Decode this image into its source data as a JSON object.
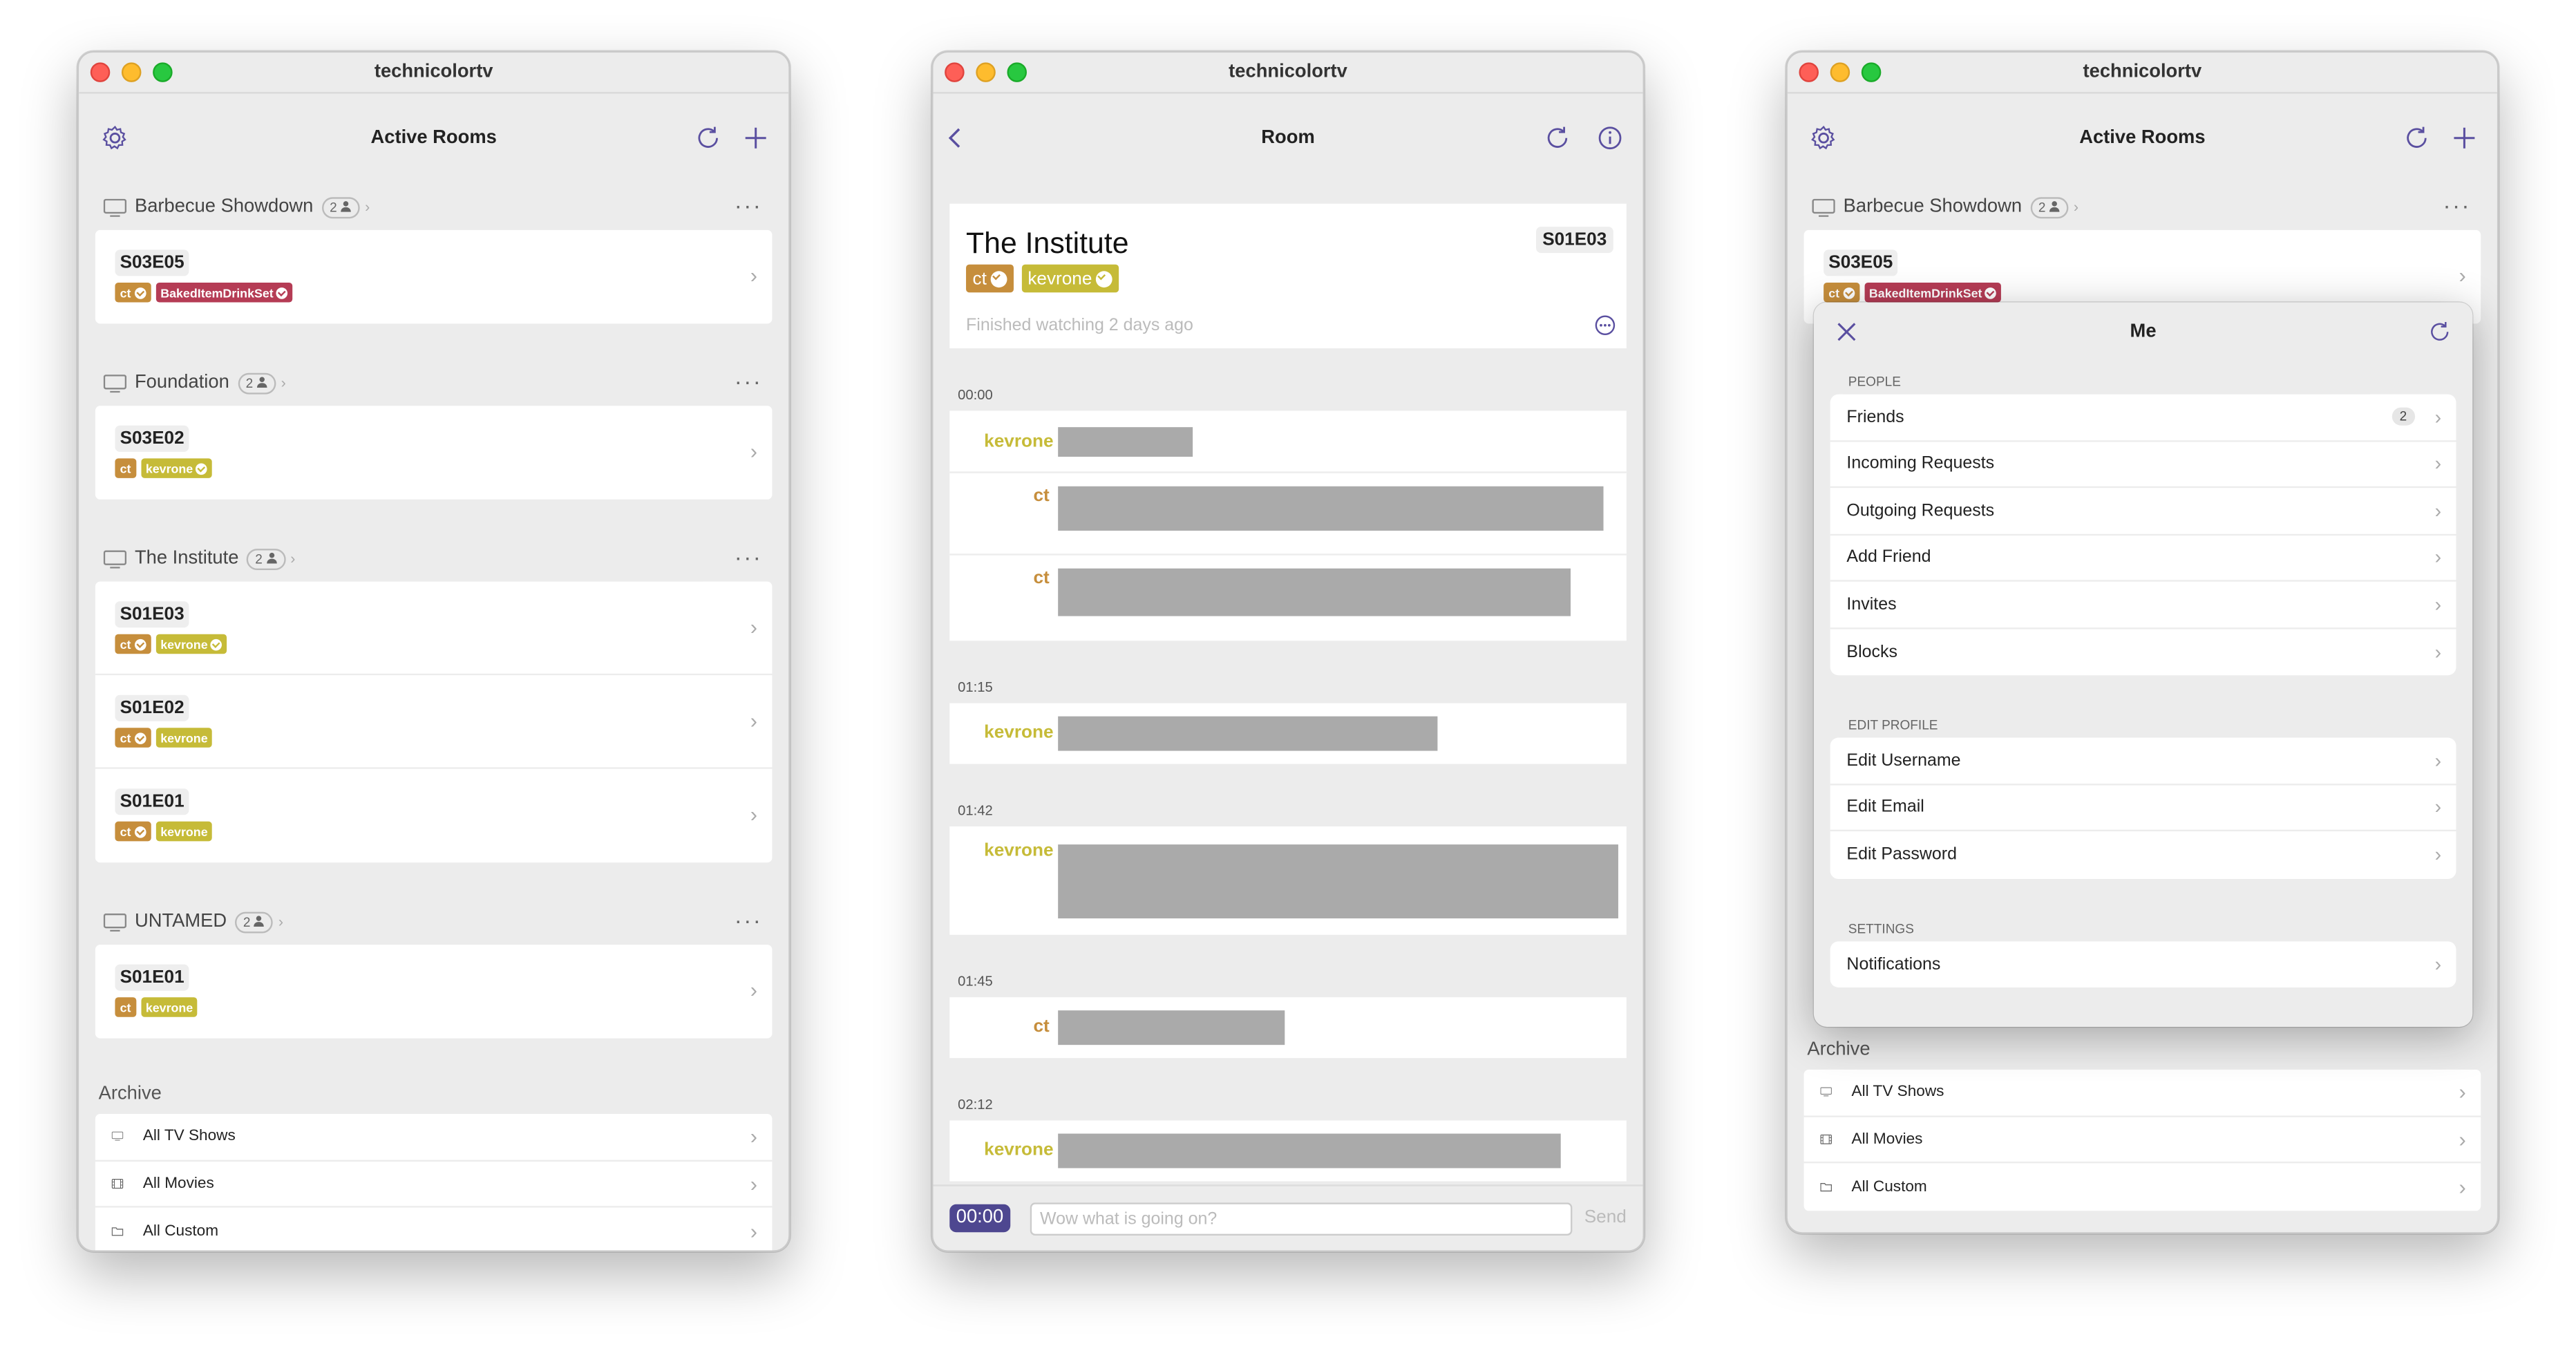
{
  "app_title": "technicolortv",
  "rooms_window": {
    "nav_title": "Active Rooms",
    "shows": [
      {
        "name": "Barbecue Showdown",
        "count": "2",
        "episodes": [
          {
            "code": "S03E05",
            "tags": [
              {
                "text": "ct",
                "checked": true,
                "color": "ct"
              },
              {
                "text": "BakedItemDrinkSet",
                "checked": true,
                "color": "bk"
              }
            ]
          }
        ]
      },
      {
        "name": "Foundation",
        "count": "2",
        "episodes": [
          {
            "code": "S03E02",
            "tags": [
              {
                "text": "ct",
                "checked": false,
                "color": "ct"
              },
              {
                "text": "kevrone",
                "checked": true,
                "color": "kev"
              }
            ]
          }
        ]
      },
      {
        "name": "The Institute",
        "count": "2",
        "episodes": [
          {
            "code": "S01E03",
            "tags": [
              {
                "text": "ct",
                "checked": true,
                "color": "ct"
              },
              {
                "text": "kevrone",
                "checked": true,
                "color": "kev"
              }
            ]
          },
          {
            "code": "S01E02",
            "tags": [
              {
                "text": "ct",
                "checked": true,
                "color": "ct"
              },
              {
                "text": "kevrone",
                "checked": false,
                "color": "kev"
              }
            ]
          },
          {
            "code": "S01E01",
            "tags": [
              {
                "text": "ct",
                "checked": true,
                "color": "ct"
              },
              {
                "text": "kevrone",
                "checked": false,
                "color": "kev"
              }
            ]
          }
        ]
      },
      {
        "name": "UNTAMED",
        "count": "2",
        "episodes": [
          {
            "code": "S01E01",
            "tags": [
              {
                "text": "ct",
                "checked": false,
                "color": "ct"
              },
              {
                "text": "kevrone",
                "checked": false,
                "color": "kev"
              }
            ]
          }
        ]
      }
    ],
    "archive_title": "Archive",
    "archive_items": [
      {
        "label": "All TV Shows",
        "icon": "tv-icon"
      },
      {
        "label": "All Movies",
        "icon": "film-icon"
      },
      {
        "label": "All Custom",
        "icon": "folder-icon"
      }
    ]
  },
  "room_window": {
    "nav_title": "Room",
    "show_title": "The Institute",
    "episode": "S01E03",
    "participants": [
      {
        "text": "ct",
        "color": "ct"
      },
      {
        "text": "kevrone",
        "color": "kev"
      }
    ],
    "status": "Finished watching 2 days ago",
    "timestamps": [
      "00:00",
      "01:15",
      "01:42",
      "01:45",
      "02:12"
    ],
    "authors": [
      "kevrone",
      "ct",
      "ct",
      "kevrone",
      "kevrone",
      "ct",
      "kevrone"
    ],
    "composer": {
      "time": "00:00",
      "placeholder": "Wow what is going on?",
      "send": "Send"
    }
  },
  "me_popover": {
    "title": "Me",
    "people_header": "PEOPLE",
    "people": [
      "Friends",
      "Incoming Requests",
      "Outgoing Requests",
      "Add Friend",
      "Invites",
      "Blocks"
    ],
    "friends_count": "2",
    "edit_header": "EDIT PROFILE",
    "edit": [
      "Edit Username",
      "Edit Email",
      "Edit Password"
    ],
    "settings_header": "SETTINGS",
    "settings": [
      "Notifications"
    ]
  },
  "colors": {
    "ct": "#c68e3c",
    "kevrone": "#c6bb38",
    "baked": "#b53c55",
    "accent": "#4e4790"
  }
}
